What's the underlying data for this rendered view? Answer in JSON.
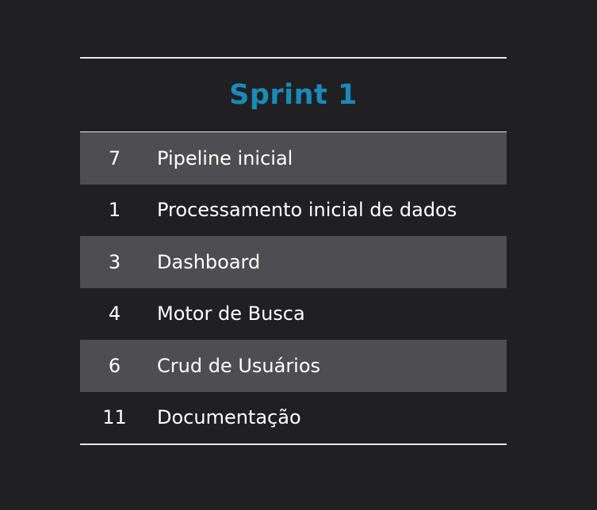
{
  "title": "Sprint 1",
  "colors": {
    "background": "#202023",
    "title": "#1a8ab8",
    "shaded_row": "#4e4e52",
    "text": "#ffffff",
    "rule": "#e6e6e6"
  },
  "rows": [
    {
      "number": "7",
      "label": "Pipeline inicial"
    },
    {
      "number": "1",
      "label": "Processamento inicial de dados"
    },
    {
      "number": "3",
      "label": "Dashboard"
    },
    {
      "number": "4",
      "label": "Motor de Busca"
    },
    {
      "number": "6",
      "label": "Crud de Usuários"
    },
    {
      "number": "11",
      "label": "Documentação"
    }
  ]
}
